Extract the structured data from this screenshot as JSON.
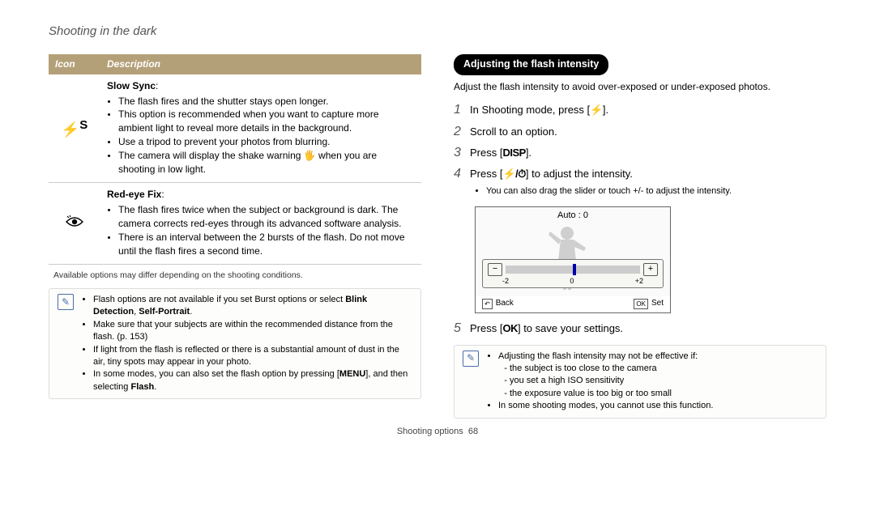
{
  "section_title": "Shooting in the dark",
  "table": {
    "headers": [
      "Icon",
      "Description"
    ],
    "rows": [
      {
        "icon": "flash-slow-sync",
        "title": "Slow Sync",
        "bullets": [
          "The flash fires and the shutter stays open longer.",
          "This option is recommended when you want to capture more ambient light to reveal more details in the background.",
          "Use a tripod to prevent your photos from blurring.",
          "The camera will display the shake warning 🖐 when you are shooting in low light."
        ]
      },
      {
        "icon": "red-eye-fix",
        "title": "Red-eye Fix",
        "bullets": [
          "The flash fires twice when the subject or background is dark. The camera corrects red-eyes through its advanced software analysis.",
          "There is an interval between the 2 bursts of the flash. Do not move until the flash fires a second time."
        ]
      }
    ]
  },
  "footnote": "Available options may differ depending on the shooting conditions.",
  "note_left": {
    "items": [
      {
        "prefix": "Flash options are not available if you set Burst options or select ",
        "bold1": "Blink Detection",
        "mid": ", ",
        "bold2": "Self-Portrait",
        "suffix": "."
      },
      {
        "text": "Make sure that your subjects are within the recommended distance from the flash. (p. 153)"
      },
      {
        "text": "If light from the flash is reflected or there is a substantial amount of dust in the air, tiny spots may appear in your photo."
      },
      {
        "prefix": "In some modes, you can also set the flash option by pressing [",
        "bold1": "MENU",
        "mid": "], and then selecting ",
        "bold2": "Flash",
        "suffix": "."
      }
    ]
  },
  "right": {
    "subheading": "Adjusting the flash intensity",
    "intro": "Adjust the flash intensity to avoid over-exposed or under-exposed photos.",
    "steps": [
      {
        "num": "1",
        "pre": "In Shooting mode, press [",
        "key": "⚡",
        "post": "]."
      },
      {
        "num": "2",
        "pre": "Scroll to an option.",
        "key": "",
        "post": ""
      },
      {
        "num": "3",
        "pre": "Press [",
        "key": "DISP",
        "post": "]."
      },
      {
        "num": "4",
        "pre": "Press [",
        "key": "⚡/⏱",
        "post": "] to adjust the intensity."
      }
    ],
    "step4_sub": "You can also drag the slider or touch +/- to adjust the intensity.",
    "lcd": {
      "title": "Auto : 0",
      "minus": "−",
      "plus": "+",
      "labels": [
        "-2",
        "0",
        "+2"
      ],
      "back_label": "Back",
      "set_label": "Set",
      "back_key": "↶",
      "set_key": "OK"
    },
    "step5": {
      "num": "5",
      "pre": "Press [",
      "key": "OK",
      "post": "] to save your settings."
    },
    "note": {
      "lead": "Adjusting the flash intensity may not be effective if:",
      "subs": [
        "the subject is too close to the camera",
        "you set a high ISO sensitivity",
        "the exposure value is too big or too small"
      ],
      "last": "In some shooting modes, you cannot use this function."
    }
  },
  "page_footer": {
    "chapter": "Shooting options",
    "num": "68"
  }
}
